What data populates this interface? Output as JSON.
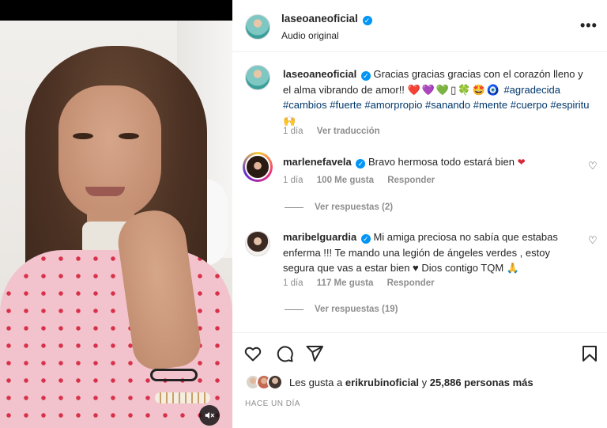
{
  "post": {
    "author": "laseoaneoficial",
    "audio_label": "Audio original",
    "more_label": "•••"
  },
  "caption": {
    "username": "laseoaneoficial",
    "text": "Gracias gracias gracias con el corazón lleno y el alma vibrando de amor!!",
    "emojis": "❤️💜💚▯🍀🤩🧿",
    "hashtags": [
      "#agradecida",
      "#cambios",
      "#fuerte",
      "#amorpropio",
      "#sanando",
      "#mente",
      "#cuerpo",
      "#espiritu"
    ],
    "end_emoji": "🙌",
    "time": "1 día",
    "translate_label": "Ver traducción"
  },
  "comments": [
    {
      "username": "marlenefavela",
      "text": "Bravo hermosa todo estará bien",
      "end_emoji": "❤",
      "time": "1 día",
      "likes": "100 Me gusta",
      "reply_label": "Responder",
      "view_replies": "Ver respuestas (2)"
    },
    {
      "username": "maribelguardia",
      "text": "Mi amiga preciosa no sabía que estabas enferma !!! Te mando una legión de ángeles verdes , estoy segura que vas a estar bien ♥ Dios contigo TQM",
      "end_emoji": "🙏",
      "time": "1 día",
      "likes": "117 Me gusta",
      "reply_label": "Responder",
      "view_replies": "Ver respuestas (19)"
    }
  ],
  "likes": {
    "prefix": "Les gusta a",
    "first_user": "erikrubinoficial",
    "joiner": "y",
    "others": "25,886 personas más"
  },
  "timestamp": "HACE UN DÍA",
  "icons": {
    "like": "heart-outline-icon",
    "comment": "speech-bubble-icon",
    "share": "paper-plane-icon",
    "save": "bookmark-icon",
    "sound": "speaker-muted-icon"
  },
  "colors": {
    "verified": "#0095f6",
    "hashtag": "#00376b",
    "muted_text": "#8e8e8e",
    "heart": "#d8283a"
  }
}
